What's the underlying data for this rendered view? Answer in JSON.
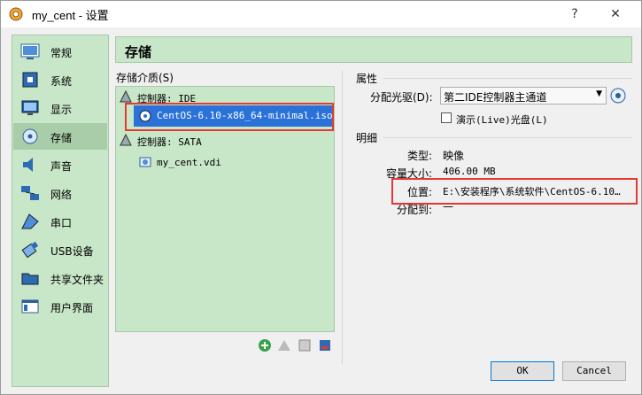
{
  "window": {
    "title": "my_cent - 设置",
    "help_glyph": "?",
    "close_glyph": "✕"
  },
  "sidebar": {
    "items": [
      {
        "label": "常规",
        "icon": "general-icon"
      },
      {
        "label": "系统",
        "icon": "chip-icon"
      },
      {
        "label": "显示",
        "icon": "monitor-icon"
      },
      {
        "label": "存储",
        "icon": "disk-icon",
        "active": true
      },
      {
        "label": "声音",
        "icon": "speaker-icon"
      },
      {
        "label": "网络",
        "icon": "network-icon"
      },
      {
        "label": "串口",
        "icon": "serial-port-icon"
      },
      {
        "label": "USB设备",
        "icon": "usb-icon"
      },
      {
        "label": "共享文件夹",
        "icon": "folder-icon"
      },
      {
        "label": "用户界面",
        "icon": "window-icon"
      }
    ]
  },
  "header": {
    "title": "存储"
  },
  "storage": {
    "label": "存储介质(S)",
    "tree": {
      "ide_controller": "控制器: IDE",
      "ide_disk": "CentOS-6.10-x86_64-minimal.iso",
      "sata_controller": "控制器: SATA",
      "sata_disk": "my_cent.vdi"
    }
  },
  "attributes": {
    "section_label": "属性",
    "drive_label": "分配光驱(D):",
    "drive_value": "第二IDE控制器主通道",
    "live_cd_label": "演示(Live)光盘(L)",
    "live_cd_checked": false
  },
  "details": {
    "section_label": "明细",
    "type_label": "类型:",
    "type_value": "映像",
    "size_label": "容量大小:",
    "size_value": "406.00 MB",
    "location_label": "位置:",
    "location_value": "E:\\安装程序\\系统软件\\CentOS-6.10…",
    "attached_label": "分配到:",
    "attached_value": "—"
  },
  "buttons": {
    "ok": "OK",
    "cancel": "Cancel"
  },
  "accent": {
    "sidebar_bg": "#c8e6c8",
    "selection": "#2a72d8",
    "highlight": "#e53935"
  }
}
